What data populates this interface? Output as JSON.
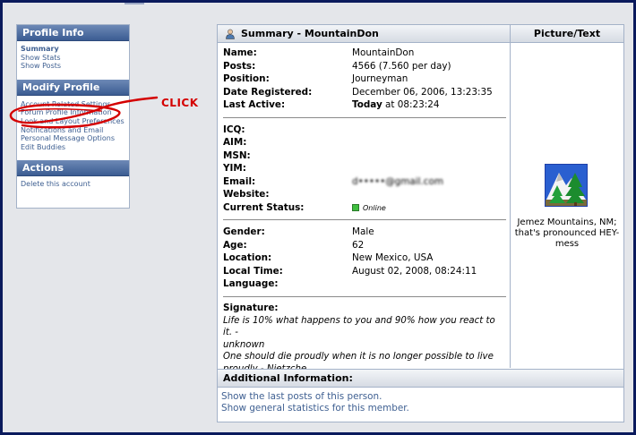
{
  "left": {
    "profile_info": {
      "title": "Profile Info",
      "links": [
        "Summary",
        "Show Stats",
        "Show Posts"
      ]
    },
    "modify_profile": {
      "title": "Modify Profile",
      "links": [
        "Account Related Settings",
        "Forum Profile Information",
        "Look and Layout Preferences",
        "Notifications and Email",
        "Personal Message Options",
        "Edit Buddies"
      ]
    },
    "actions": {
      "title": "Actions",
      "links": [
        "Delete this account"
      ]
    }
  },
  "annotation": {
    "label": "CLICK",
    "color": "#d40000"
  },
  "summary": {
    "title": "Summary - MountainDon",
    "group1": [
      {
        "k": "Name:",
        "v": "MountainDon"
      },
      {
        "k": "Posts:",
        "v": "4566 (7.560 per day)"
      },
      {
        "k": "Position:",
        "v": "Journeyman"
      },
      {
        "k": "Date Registered:",
        "v": "December 06, 2006, 13:23:35"
      },
      {
        "k": "Last Active:",
        "v_bold": "Today",
        "v": " at 08:23:24"
      }
    ],
    "group2": [
      {
        "k": "ICQ:",
        "v": ""
      },
      {
        "k": "AIM:",
        "v": ""
      },
      {
        "k": "MSN:",
        "v": ""
      },
      {
        "k": "YIM:",
        "v": ""
      },
      {
        "k": "Email:",
        "v": "d•••••@gmail.com"
      },
      {
        "k": "Website:",
        "v": ""
      },
      {
        "k": "Current Status:",
        "v": "Online"
      }
    ],
    "group3": [
      {
        "k": "Gender:",
        "v": "Male"
      },
      {
        "k": "Age:",
        "v": "62"
      },
      {
        "k": "Location:",
        "v": "New Mexico, USA"
      },
      {
        "k": "Local Time:",
        "v": "August 02, 2008, 08:24:11"
      },
      {
        "k": "Language:",
        "v": ""
      }
    ],
    "signature_label": "Signature:",
    "signature_lines": [
      "Life is 10% what happens to you and 90% how you react to it. -",
      "unknown",
      "One should die proudly when it is no longer possible to live",
      "proudly - Nietzche"
    ]
  },
  "picture": {
    "title": "Picture/Text",
    "avatar_icon": "mountain-trees-icon",
    "caption": "Jemez Mountains, NM; that's pronounced HEY-mess"
  },
  "additional": {
    "title": "Additional Information:",
    "links": [
      "Show the last posts of this person.",
      "Show general statistics for this member."
    ]
  },
  "colors": {
    "link": "#3e5f91",
    "header_blue": "#3b5c92",
    "online": "#3fbf3f"
  }
}
